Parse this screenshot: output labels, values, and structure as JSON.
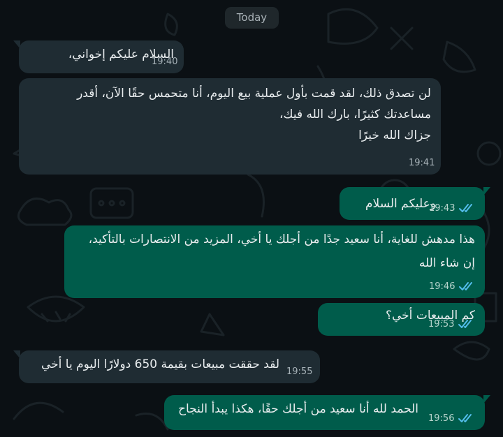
{
  "chat": {
    "date_divider": "Today",
    "messages": [
      {
        "direction": "incoming",
        "lines": [
          "السلام عليكم إخواني،"
        ],
        "time": "19:40"
      },
      {
        "direction": "incoming",
        "lines": [
          "لن تصدق ذلك، لقد قمت بأول عملية بيع اليوم، أنا متحمس حقًا الآن، أقدر",
          "مساعدتك كثيرًا، بارك الله فيك،",
          "جزاك الله خيرًا"
        ],
        "time": "19:41"
      },
      {
        "direction": "outgoing",
        "lines": [
          "وعليكم السلام"
        ],
        "time": "19:43",
        "status": "read"
      },
      {
        "direction": "outgoing",
        "lines": [
          "هذا مدهش للغاية، أنا سعيد جدًا من أجلك يا أخي، المزيد من الانتصارات بالتأكيد،",
          "إن شاء الله"
        ],
        "time": "19:46",
        "status": "read"
      },
      {
        "direction": "outgoing",
        "lines": [
          "كم المبيعات أخي؟"
        ],
        "time": "19:53",
        "status": "read"
      },
      {
        "direction": "incoming",
        "lines": [
          "لقد حققت مبيعات بقيمة 650 دولارًا اليوم يا أخي"
        ],
        "time": "19:55"
      },
      {
        "direction": "outgoing",
        "lines": [
          "الحمد لله أنا سعيد من أجلك حقًا، هكذا يبدأ النجاح"
        ],
        "time": "19:56",
        "status": "read"
      }
    ]
  },
  "colors": {
    "background": "#0b1014",
    "incoming_bubble": "#1f2c33",
    "outgoing_bubble": "#005c4b",
    "read_ticks": "#53bdeb"
  },
  "icons": {
    "read_receipt": "double-check-icon",
    "wallpaper": "doodle-pattern"
  }
}
